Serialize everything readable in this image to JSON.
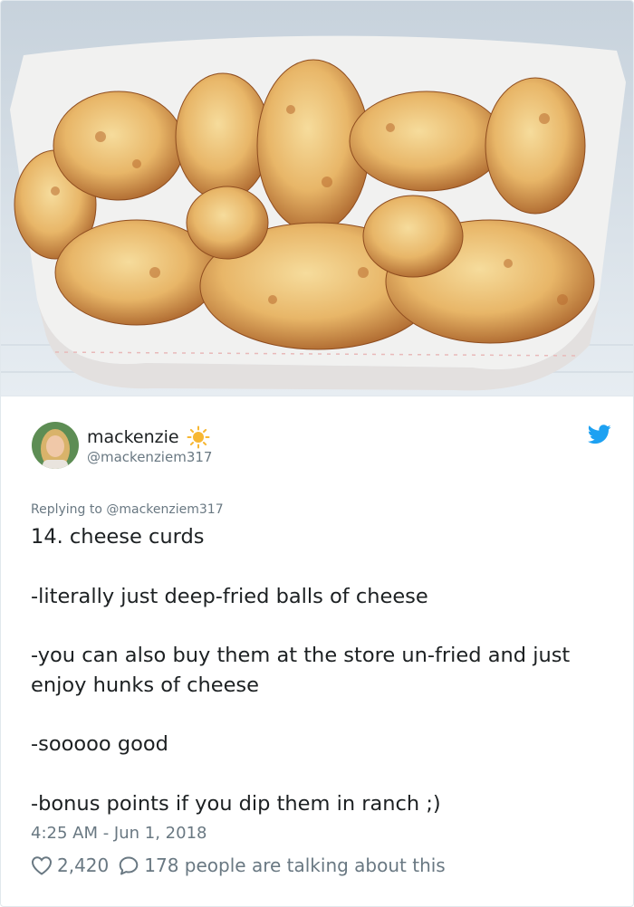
{
  "user": {
    "name": "mackenzie",
    "handle": "@mackenziem317",
    "emoji_icon": "sun-icon"
  },
  "tweet": {
    "reply_prefix": "Replying to ",
    "reply_to": "@mackenziem317",
    "paragraphs": [
      "14. cheese curds",
      "-literally just deep-fried balls of cheese",
      "-you can also buy them at the store un-fried and just enjoy hunks of cheese",
      "-sooooo good",
      "-bonus points if you dip them in ranch ;)"
    ],
    "timestamp": "4:25 AM - Jun 1, 2018"
  },
  "engagement": {
    "likes": "2,420",
    "talking": "178 people are talking about this"
  },
  "colors": {
    "twitter_blue": "#1da1f2",
    "muted_text": "#697882",
    "sun_yellow": "#f7b733"
  }
}
